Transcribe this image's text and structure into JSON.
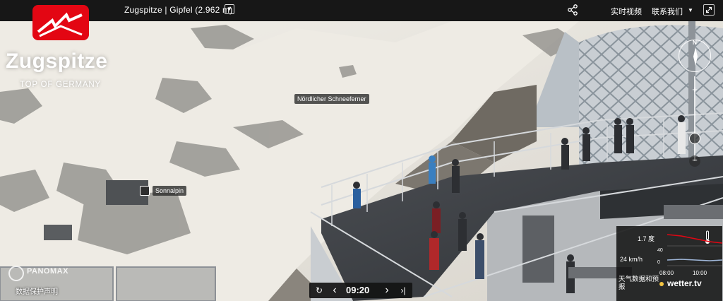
{
  "app": {
    "title": "Zugspitze | Gipfel (2.962 m)"
  },
  "topbar": {
    "title_dropdown": "▼",
    "live_video": "实时视频",
    "contact_us": "联系我们",
    "contact_dropdown": "▼"
  },
  "logo": {
    "name": "Zugspitze",
    "subtitle": "TOP OF GERMANY"
  },
  "labels": {
    "glacier": "Nördlicher Schneeferner",
    "restaurant": "Sonnalpin"
  },
  "compass": {
    "north": "N"
  },
  "zoom": {
    "plus": "+",
    "minus": "−"
  },
  "playback": {
    "time": "09:20",
    "replay": "↻",
    "prev": "‹",
    "next": "›",
    "end": "›|"
  },
  "watermark": {
    "brand": "PANOMAX",
    "privacy": "数据保护声明"
  },
  "weather": {
    "temperature": "1.7 度",
    "wind": "24 km/h",
    "tick_high": "40",
    "tick_low": "0",
    "time_start": "08:00",
    "time_end": "10:00",
    "forecast": "天气数据和预报",
    "brand": "wetter.tv",
    "accent": "#e30613"
  },
  "icons": {
    "share": "share-icon",
    "fullscreen": "fullscreen-icon",
    "thermometer": "thermometer-icon",
    "sun": "sun-icon"
  }
}
